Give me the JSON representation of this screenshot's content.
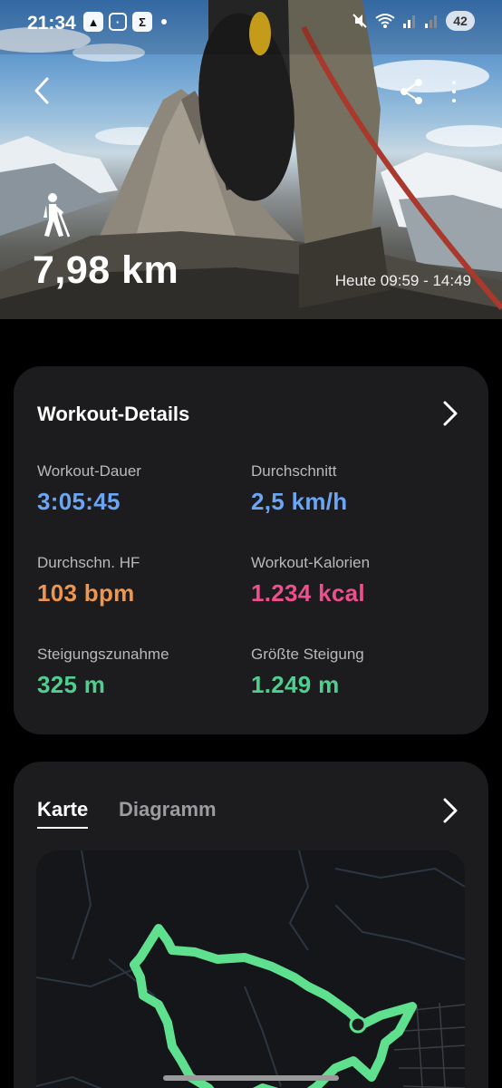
{
  "status_bar": {
    "time": "21:34",
    "battery": "42",
    "icons": [
      "navigation-app-icon",
      "screenshot-icon",
      "sigma-app-icon",
      "notification-dot",
      "mute-icon",
      "wifi-icon",
      "signal-icon",
      "signal-icon-2"
    ]
  },
  "hero": {
    "activity_icon": "hiker-icon",
    "distance": "7,98 km",
    "date_range": "Heute 09:59 - 14:49"
  },
  "details": {
    "title": "Workout-Details",
    "stats": [
      {
        "label": "Workout-Dauer",
        "value": "3:05:45",
        "color": "#6aa6f3"
      },
      {
        "label": "Durchschnitt",
        "value": "2,5 km/h",
        "color": "#6aa6f3"
      },
      {
        "label": "Durchschn. HF",
        "value": "103 bpm",
        "color": "#ee9650"
      },
      {
        "label": "Workout-Kalorien",
        "value": "1.234 kcal",
        "color": "#ee4f8e"
      },
      {
        "label": "Steigungszunahme",
        "value": "325 m",
        "color": "#4fcf8f"
      },
      {
        "label": "Größte Steigung",
        "value": "1.249 m",
        "color": "#4fcf8f"
      }
    ]
  },
  "map_card": {
    "tabs": [
      {
        "label": "Karte",
        "active": true
      },
      {
        "label": "Diagramm",
        "active": false
      }
    ],
    "route_color": "#5fe08e"
  }
}
